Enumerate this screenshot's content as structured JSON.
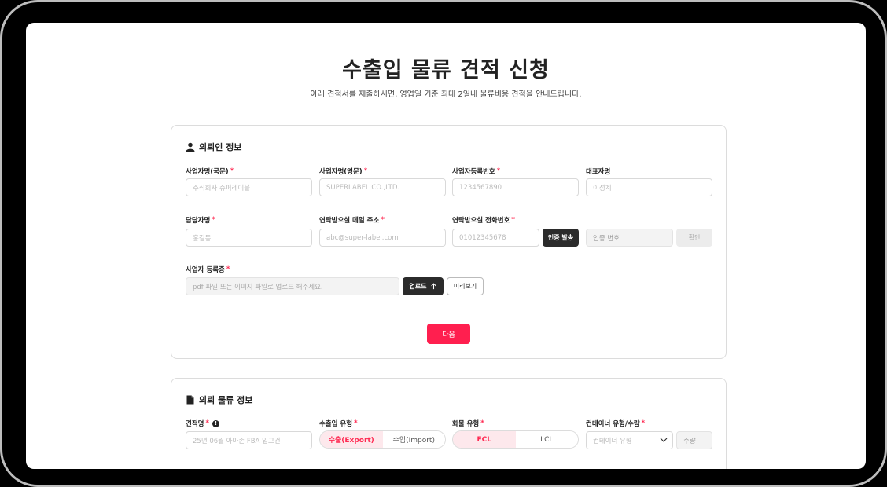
{
  "page": {
    "title": "수출입 물류 견적 신청",
    "subtitle": "아래 견적서를 제출하시면, 영업일 기준 최대 2일내 물류비용 견적을 안내드립니다."
  },
  "requester": {
    "section_title": "의뢰인 정보",
    "fields": {
      "company_kr": {
        "label": "사업자명(국문)",
        "placeholder": "주식회사 슈퍼레이블"
      },
      "company_en": {
        "label": "사업자명(영문)",
        "placeholder": "SUPERLABEL CO.,LTD."
      },
      "biz_no": {
        "label": "사업자등록번호",
        "placeholder": "1234567890"
      },
      "ceo": {
        "label": "대표자명",
        "placeholder": "이성계"
      },
      "manager": {
        "label": "담당자명",
        "placeholder": "홍길동"
      },
      "email": {
        "label": "연락받으실 메일 주소",
        "placeholder": "abc@super-label.com"
      },
      "phone": {
        "label": "연락받으실 전화번호",
        "placeholder": "01012345678",
        "send_button": "인증 발송"
      },
      "auth": {
        "placeholder": "인증 번호",
        "confirm_button": "확인"
      },
      "cert": {
        "label": "사업자 등록증",
        "placeholder": "pdf 파일 또는 이미지 파일로 업로드 해주세요.",
        "upload_button": "업로드",
        "preview_button": "미리보기"
      }
    },
    "required_mark": "*",
    "next_button": "다음"
  },
  "logistics": {
    "section_title": "의뢰 물류 정보",
    "quote_name": {
      "label": "견적명",
      "placeholder": "25년 06월 아마존 FBA 입고건",
      "info": "!"
    },
    "trade_type": {
      "label": "수출입 유형",
      "options": [
        "수출(Export)",
        "수입(Import)"
      ],
      "selected": "수출(Export)"
    },
    "cargo_type": {
      "label": "화물 유형",
      "options": [
        "FCL",
        "LCL"
      ],
      "selected": "FCL"
    },
    "container": {
      "label": "컨테이너 유형/수량",
      "placeholder": "컨테이너 유형",
      "qty_placeholder": "수량"
    }
  },
  "colors": {
    "accent": "#ff1f4f",
    "dark": "#2b2b2b"
  }
}
